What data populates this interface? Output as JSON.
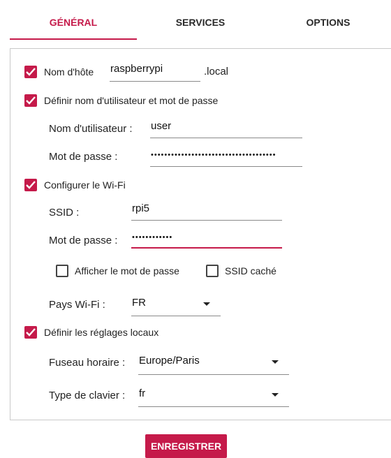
{
  "tabs": [
    {
      "label": "GÉNÉRAL",
      "active": true
    },
    {
      "label": "SERVICES",
      "active": false
    },
    {
      "label": "OPTIONS",
      "active": false
    }
  ],
  "hostname": {
    "label": "Nom d'hôte",
    "value": "raspberrypi",
    "suffix": ".local",
    "checked": true
  },
  "user": {
    "label": "Définir nom d'utilisateur et mot de passe",
    "checked": true,
    "username_label": "Nom d'utilisateur :",
    "username_value": "user",
    "password_label": "Mot de passe :",
    "password_value": "•••••••••••••••••••••••••••••••••••••"
  },
  "wifi": {
    "label": "Configurer le Wi-Fi",
    "checked": true,
    "ssid_label": "SSID :",
    "ssid_value": "rpi5",
    "password_label": "Mot de passe :",
    "password_value": "••••••••••••",
    "show_password_label": "Afficher le mot de passe",
    "show_password_checked": false,
    "hidden_ssid_label": "SSID caché",
    "hidden_ssid_checked": false,
    "country_label": "Pays Wi-Fi :",
    "country_value": "FR"
  },
  "locale": {
    "label": "Définir les réglages locaux",
    "checked": true,
    "timezone_label": "Fuseau horaire :",
    "timezone_value": "Europe/Paris",
    "keyboard_label": "Type de clavier :",
    "keyboard_value": "fr"
  },
  "save_button": "ENREGISTRER",
  "colors": {
    "accent": "#c51a4a"
  },
  "icons": {
    "checkbox_on": "check-icon",
    "dropdown": "caret-down-icon"
  }
}
